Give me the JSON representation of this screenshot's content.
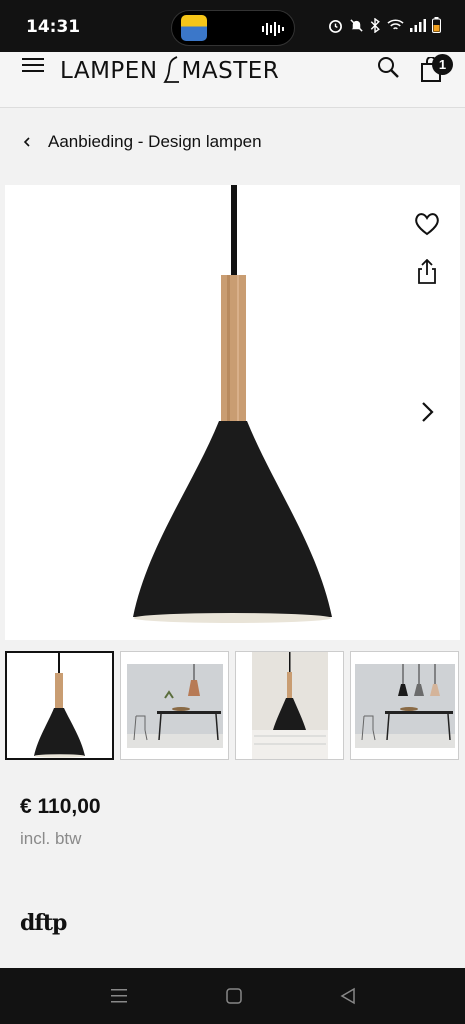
{
  "status_bar": {
    "time": "14:31",
    "icons": [
      "alarm-icon",
      "mute-icon",
      "bluetooth-icon",
      "wifi-icon",
      "signal-icon",
      "battery-icon"
    ]
  },
  "header": {
    "logo_left": "LAMPEN",
    "logo_right": "MASTER",
    "cart_count": "1"
  },
  "breadcrumb": {
    "label": "Aanbieding - Design lampen"
  },
  "gallery": {
    "thumbnails": [
      "thumb-1",
      "thumb-2",
      "thumb-3",
      "thumb-4"
    ],
    "active_index": 0
  },
  "product": {
    "price": "€ 110,00",
    "vat_note": "incl. btw",
    "brand": "dftp"
  },
  "colors": {
    "lamp_shade": "#1b1b1b",
    "wood": "#c99d72",
    "status_bar_bg": "#121212"
  }
}
